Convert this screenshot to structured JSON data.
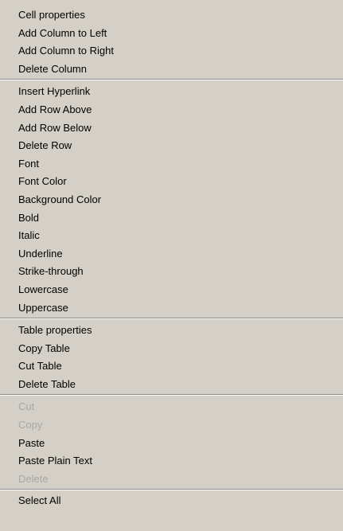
{
  "menu": {
    "groups": [
      {
        "items": [
          {
            "label": "Cell properties",
            "enabled": true
          },
          {
            "label": "Add Column to Left",
            "enabled": true
          },
          {
            "label": "Add Column to Right",
            "enabled": true
          },
          {
            "label": "Delete Column",
            "enabled": true
          }
        ]
      },
      {
        "items": [
          {
            "label": "Insert Hyperlink",
            "enabled": true
          },
          {
            "label": "Add Row Above",
            "enabled": true
          },
          {
            "label": "Add Row Below",
            "enabled": true
          },
          {
            "label": "Delete Row",
            "enabled": true
          },
          {
            "label": "Font",
            "enabled": true
          },
          {
            "label": "Font Color",
            "enabled": true
          },
          {
            "label": "Background Color",
            "enabled": true
          },
          {
            "label": "Bold",
            "enabled": true
          },
          {
            "label": "Italic",
            "enabled": true
          },
          {
            "label": "Underline",
            "enabled": true
          },
          {
            "label": "Strike-through",
            "enabled": true
          },
          {
            "label": "Lowercase",
            "enabled": true
          },
          {
            "label": "Uppercase",
            "enabled": true
          }
        ]
      },
      {
        "items": [
          {
            "label": "Table properties",
            "enabled": true
          },
          {
            "label": "Copy Table",
            "enabled": true
          },
          {
            "label": "Cut Table",
            "enabled": true
          },
          {
            "label": "Delete Table",
            "enabled": true
          }
        ]
      },
      {
        "items": [
          {
            "label": "Cut",
            "enabled": false
          },
          {
            "label": "Copy",
            "enabled": false
          },
          {
            "label": "Paste",
            "enabled": true
          },
          {
            "label": "Paste Plain Text",
            "enabled": true
          },
          {
            "label": "Delete",
            "enabled": false
          }
        ]
      },
      {
        "items": [
          {
            "label": "Select All",
            "enabled": true
          }
        ]
      }
    ],
    "colors": {
      "background": "#d4d0c8",
      "text": "#000000",
      "disabled_text": "#a8a8a8",
      "separator_dark": "#8c8c8c",
      "separator_light": "#ffffff"
    }
  }
}
